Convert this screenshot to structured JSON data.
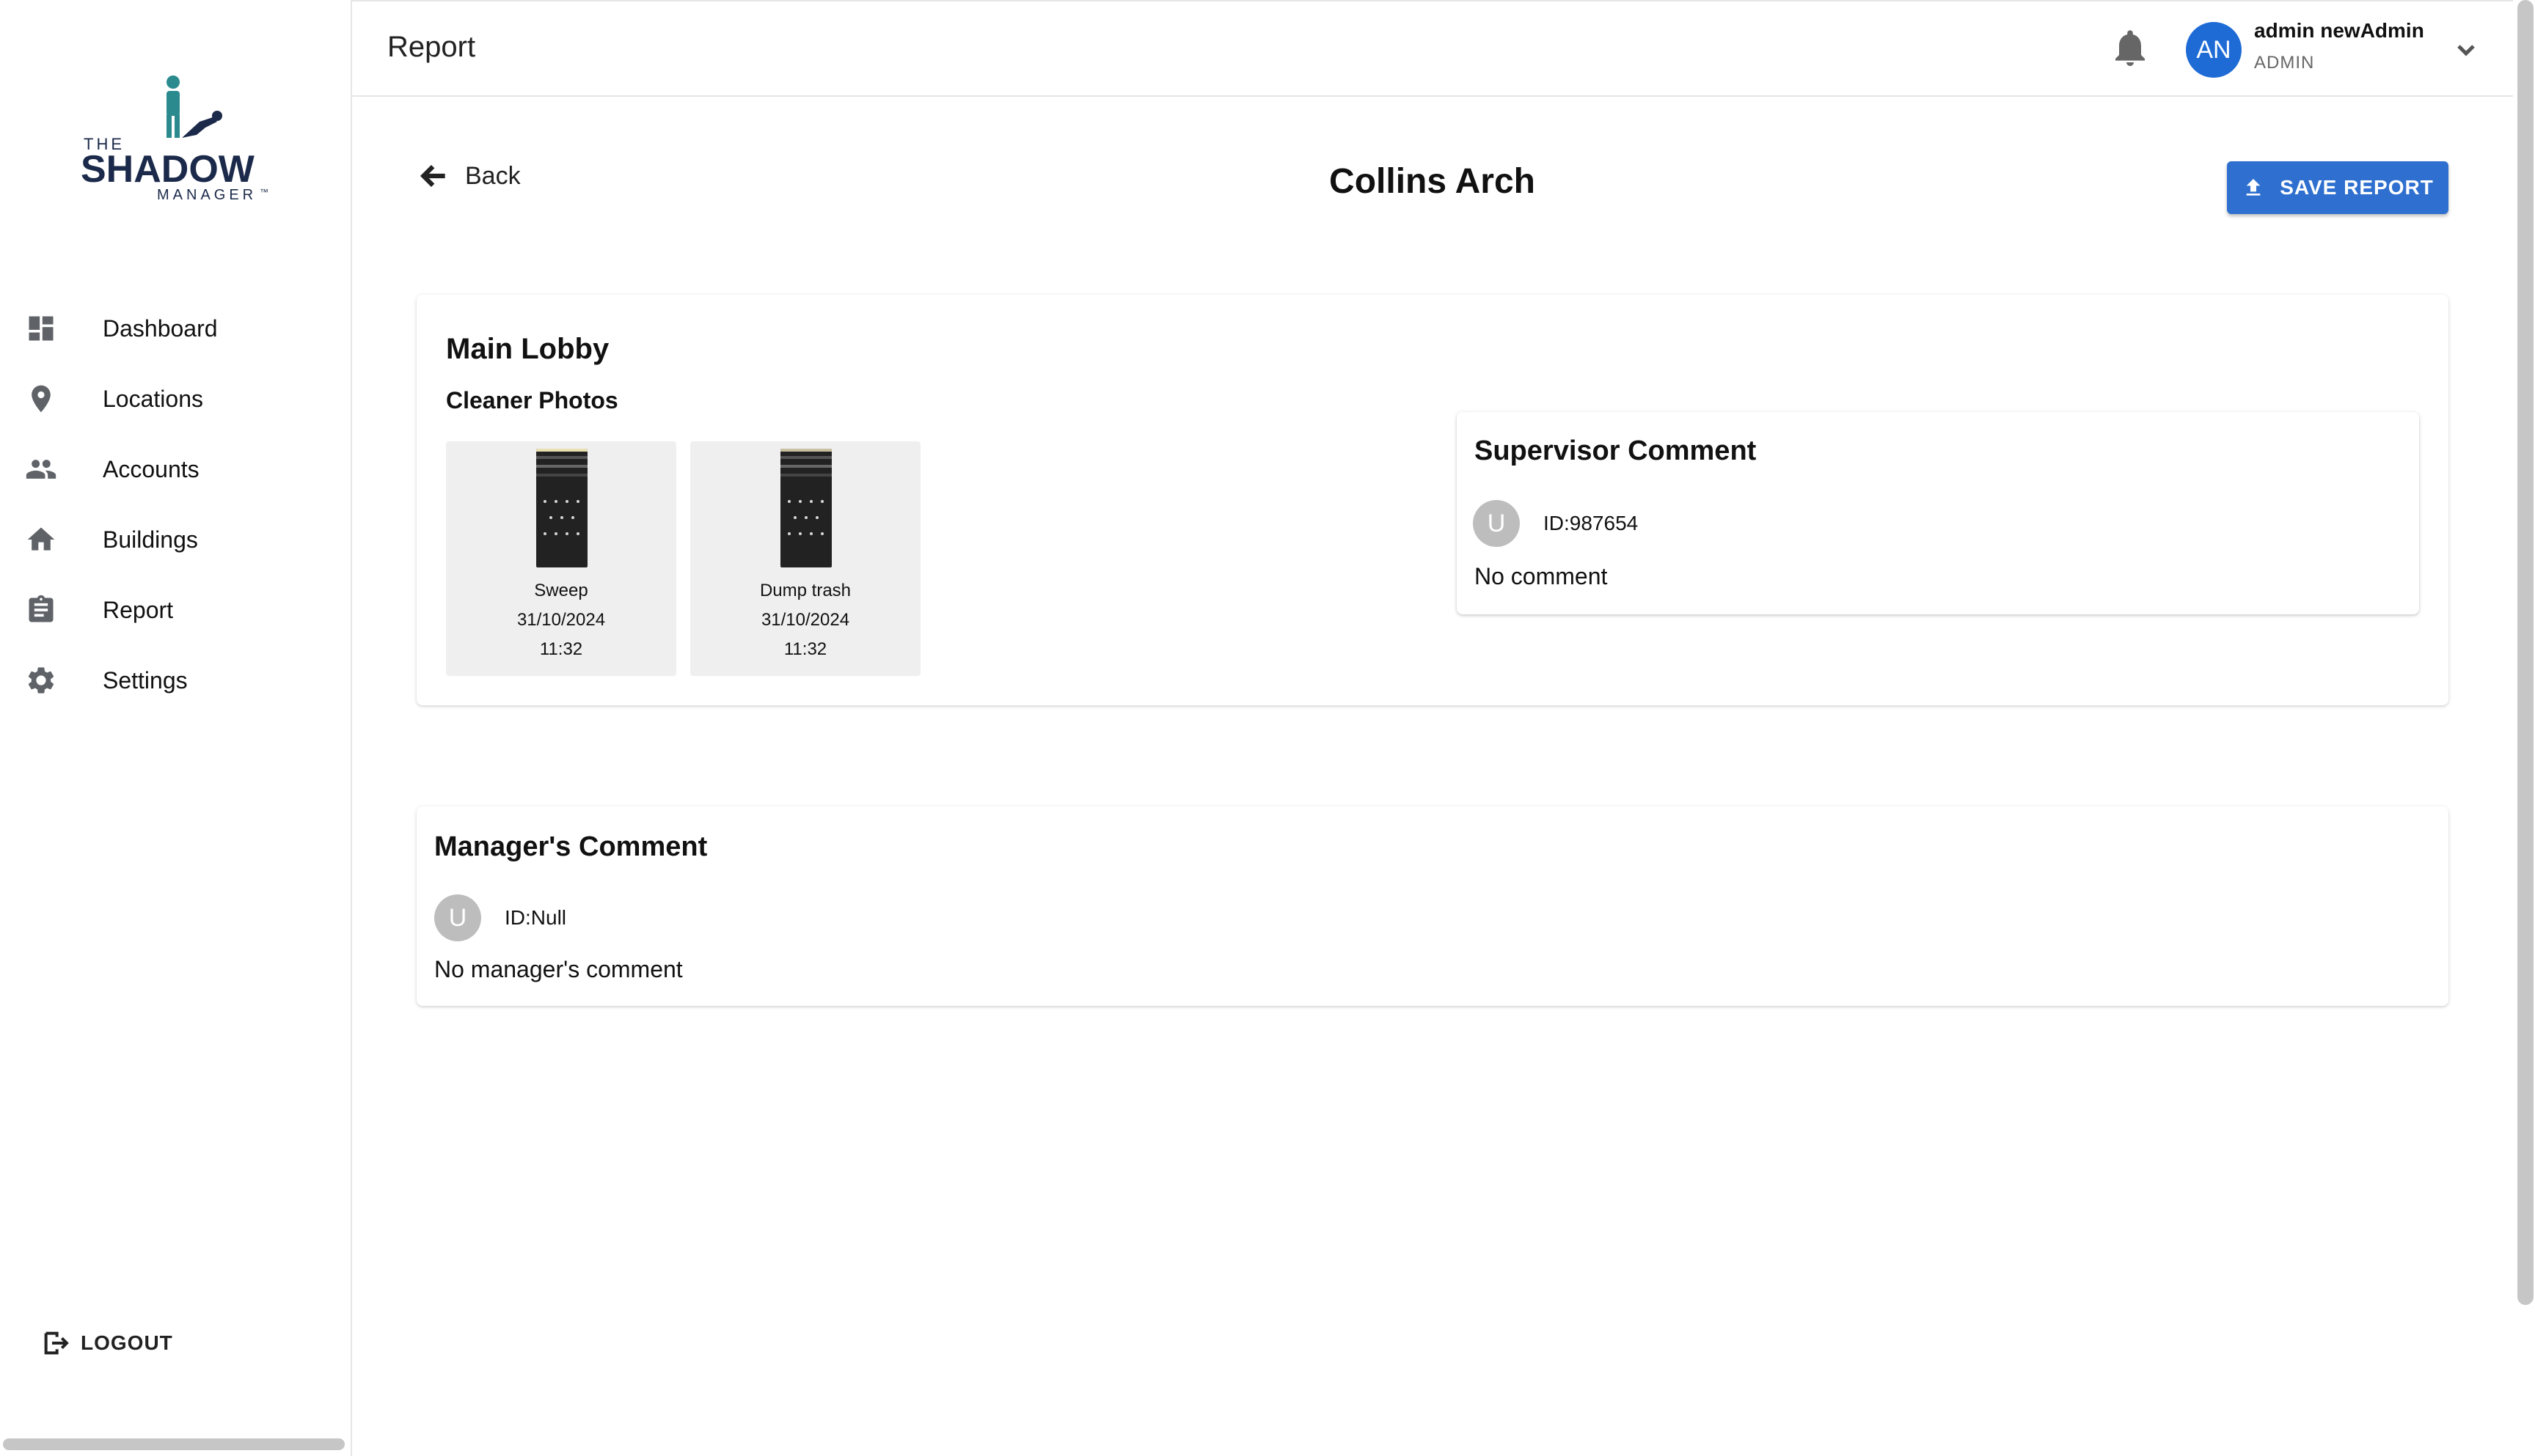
{
  "sidebar": {
    "logo": {
      "the": "THE",
      "shadow": "SHADOW",
      "manager": "MANAGER",
      "tm": "™"
    },
    "items": [
      {
        "label": "Dashboard",
        "icon": "dashboard-icon"
      },
      {
        "label": "Locations",
        "icon": "location-pin-icon"
      },
      {
        "label": "Accounts",
        "icon": "people-icon"
      },
      {
        "label": "Buildings",
        "icon": "home-icon"
      },
      {
        "label": "Report",
        "icon": "clipboard-icon"
      },
      {
        "label": "Settings",
        "icon": "gear-icon"
      }
    ],
    "logout_label": "LOGOUT"
  },
  "header": {
    "title": "Report",
    "user": {
      "initials": "AN",
      "name": "admin newAdmin",
      "role": "ADMIN"
    }
  },
  "toolbar": {
    "back_label": "Back",
    "report_title": "Collins Arch",
    "save_label": "SAVE REPORT"
  },
  "area": {
    "name": "Main Lobby",
    "photos_label": "Cleaner Photos",
    "photos": [
      {
        "task": "Sweep",
        "date": "31/10/2024",
        "time": "11:32"
      },
      {
        "task": "Dump trash",
        "date": "31/10/2024",
        "time": "11:32"
      }
    ],
    "supervisor": {
      "heading": "Supervisor Comment",
      "avatar_letter": "U",
      "id": "ID:987654",
      "comment": "No comment"
    }
  },
  "manager": {
    "heading": "Manager's Comment",
    "avatar_letter": "U",
    "id": "ID:Null",
    "comment": "No manager's comment"
  },
  "colors": {
    "primary": "#2e6fcf",
    "avatar": "#1e6bd6",
    "logo_teal": "#2a8a8e",
    "logo_navy": "#1b2a4a"
  }
}
